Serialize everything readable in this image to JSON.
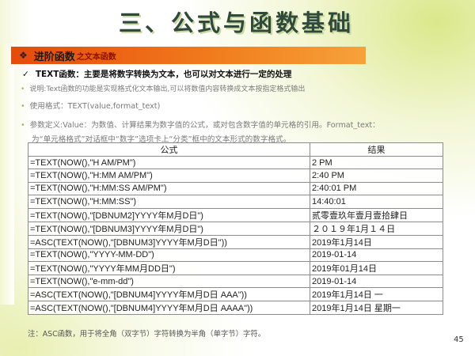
{
  "slide": {
    "title": "三、公式与函数基础",
    "banner": {
      "main": "进阶函数",
      "sub": "之文本函数",
      "bullet_icon": "diamond-bullet-icon"
    },
    "heading": {
      "check_icon": "checkmark-icon",
      "text": "TEXT函数：主要是将数字转换为文本，也可以对文本进行一定的处理"
    },
    "explain": "说明:Text函数的功能是实现格式化文本输出,可以将数值内容转换成文本按指定格式输出",
    "usage": "使用格式：TEXT(value,format_text)",
    "params_line1": "参数定义:Value：为数值、计算结果为数字值的公式，或对包含数字值的单元格的引用。Format_text：",
    "params_line2": "为“单元格格式”对话框中“数字”选项卡上“分类”框中的文本形式的数字格式。",
    "table": {
      "headers": [
        "公式",
        "结果"
      ],
      "rows": [
        [
          "=TEXT(NOW(),\"H AM/PM\")",
          "2 PM"
        ],
        [
          "=TEXT(NOW(),\"H:MM AM/PM\")",
          "2:40 PM"
        ],
        [
          "=TEXT(NOW(),\"H:MM:SS AM/PM\")",
          "2:40:01 PM"
        ],
        [
          "=TEXT(NOW(),\"H:MM:SS\")",
          "14:40:01"
        ],
        [
          "=TEXT(NOW(),\"[DBNUM2]YYYY年M月D日\")",
          "贰零壹玖年壹月壹拾肆日"
        ],
        [
          "=TEXT(NOW(),\"[DBNUM3]YYYY年M月D日\")",
          "２０１９年1月１４日"
        ],
        [
          "=ASC(TEXT(NOW(),\"[DBNUM3]YYYY年M月D日\"))",
          "2019年1月14日"
        ],
        [
          "=TEXT(NOW(),\"YYYY-MM-DD\")",
          "2019-01-14"
        ],
        [
          "=TEXT(NOW(),\"YYYY年MM月DD日\")",
          "2019年01月14日"
        ],
        [
          "=TEXT(NOW(),\"e-mm-dd\")",
          "2019-01-14"
        ],
        [
          "=ASC(TEXT(NOW(),\"[DBNUM4]YYYY年M月D日 AAA\"))",
          "2019年1月14日 一"
        ],
        [
          "=ASC(TEXT(NOW(),\"[DBNUM4]YYYY年M月D日 AAAA\"))",
          "2019年1月14日 星期一"
        ]
      ]
    },
    "note": "注：ASC函数，用于将全角（双字节）字符转换为半角（单字节）字符。",
    "page_number": "45",
    "colors": {
      "banner_start": "#e64a0c",
      "banner_end": "#f6a23a",
      "title": "#2f4a3a",
      "accent_green": "#dbe88a"
    }
  }
}
